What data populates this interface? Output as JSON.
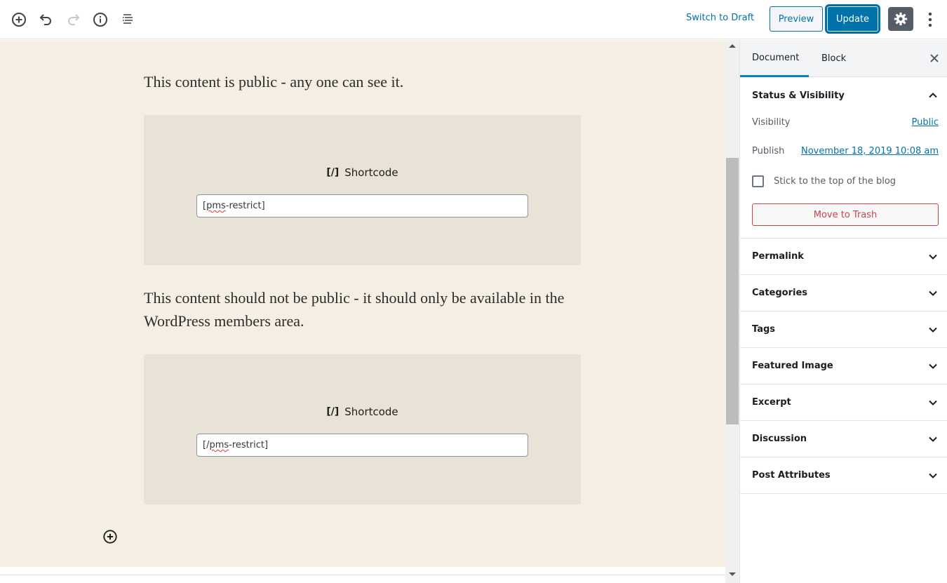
{
  "toolbar": {
    "icons": {
      "add_block": "plus-circle-icon",
      "undo": "undo-icon",
      "redo": "redo-icon",
      "info": "info-icon",
      "outline": "list-outline-icon",
      "settings": "gear-icon",
      "more": "more-vertical-icon"
    },
    "switch_to_draft": "Switch to Draft",
    "preview": "Preview",
    "update": "Update"
  },
  "editor": {
    "paragraphs": [
      "This content is public - any one can see it.",
      "This content should not be public - it should only be available in the WordPress members area."
    ],
    "shortcode_blocks": [
      {
        "icon": "[/]",
        "label": "Shortcode",
        "value_prefix": "[",
        "value_squiggle": "pms",
        "value_suffix": "-restrict]"
      },
      {
        "icon": "[/]",
        "label": "Shortcode",
        "value_prefix": "[/",
        "value_squiggle": "pms",
        "value_suffix": "-restrict]"
      }
    ],
    "add_block_icon": "plus-circle-icon"
  },
  "sidebar": {
    "tabs": [
      {
        "label": "Document",
        "active": true
      },
      {
        "label": "Block",
        "active": false
      }
    ],
    "close_icon": "close-icon",
    "status_visibility": {
      "title": "Status & Visibility",
      "expanded": true,
      "visibility_label": "Visibility",
      "visibility_value": "Public",
      "publish_label": "Publish",
      "publish_value": "November 18, 2019 10:08 am",
      "sticky_label": "Stick to the top of the blog",
      "sticky_checked": false,
      "trash_label": "Move to Trash"
    },
    "panels": [
      {
        "title": "Permalink"
      },
      {
        "title": "Categories"
      },
      {
        "title": "Tags"
      },
      {
        "title": "Featured Image"
      },
      {
        "title": "Excerpt"
      },
      {
        "title": "Discussion"
      },
      {
        "title": "Post Attributes"
      }
    ]
  },
  "colors": {
    "accent": "#0073aa",
    "canvas_bg": "#f5eee2",
    "block_bg": "#e8e2d7",
    "danger": "#c9444b"
  }
}
